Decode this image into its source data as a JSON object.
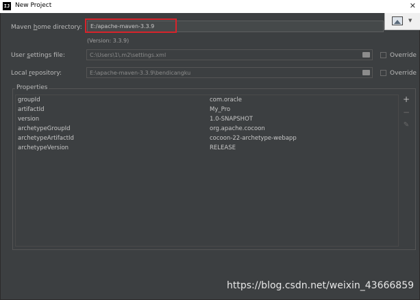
{
  "window": {
    "title": "New Project",
    "app_icon_text": "IJ",
    "close_glyph": "✕"
  },
  "form": {
    "maven_home": {
      "label_pre": "Maven ",
      "label_u": "h",
      "label_post": "ome directory:",
      "value": "E:/apache-maven-3.3.9",
      "version": "(Version: 3.3.9)"
    },
    "user_settings": {
      "label_pre": "User ",
      "label_u": "s",
      "label_post": "ettings file:",
      "value": "C:\\Users\\1\\.m2\\settings.xml",
      "override_label": "Override"
    },
    "local_repo": {
      "label_pre": "Local ",
      "label_u": "r",
      "label_post": "epository:",
      "value": "E:\\apache-maven-3.3.9\\bendicangku",
      "override_label": "Override"
    }
  },
  "properties": {
    "title": "Properties",
    "rows": [
      {
        "key": "groupId",
        "value": "com.oracle"
      },
      {
        "key": "artifactId",
        "value": "My_Pro"
      },
      {
        "key": "version",
        "value": "1.0-SNAPSHOT"
      },
      {
        "key": "archetypeGroupId",
        "value": "org.apache.cocoon"
      },
      {
        "key": "archetypeArtifactId",
        "value": "cocoon-22-archetype-webapp"
      },
      {
        "key": "archetypeVersion",
        "value": "RELEASE"
      }
    ],
    "add_glyph": "+",
    "remove_glyph": "−",
    "edit_glyph": "✎"
  },
  "watermark": {
    "text": "https://blog.csdn.net/weixin_43666859"
  },
  "colors": {
    "background": "#3c3f41",
    "highlight": "#d9232b"
  }
}
